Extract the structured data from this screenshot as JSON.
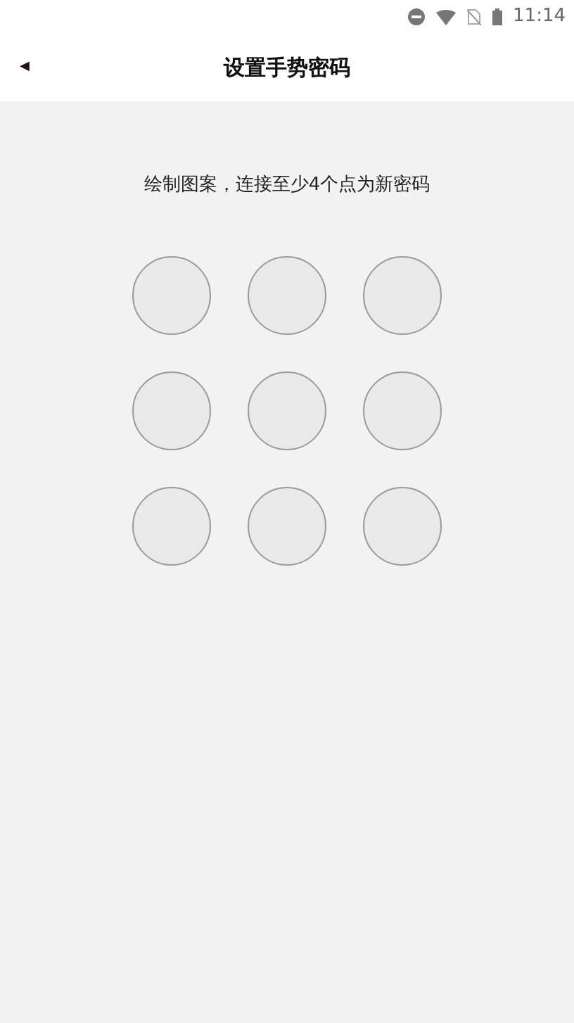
{
  "status_bar": {
    "time": "11:14"
  },
  "header": {
    "back": "◀",
    "title": "设置手势密码"
  },
  "instruction": "绘制图案，连接至少4个点为新密码",
  "pattern_dots": [
    {
      "selected": false
    },
    {
      "selected": false
    },
    {
      "selected": false
    },
    {
      "selected": false
    },
    {
      "selected": false
    },
    {
      "selected": false
    },
    {
      "selected": false
    },
    {
      "selected": false
    },
    {
      "selected": false
    }
  ]
}
